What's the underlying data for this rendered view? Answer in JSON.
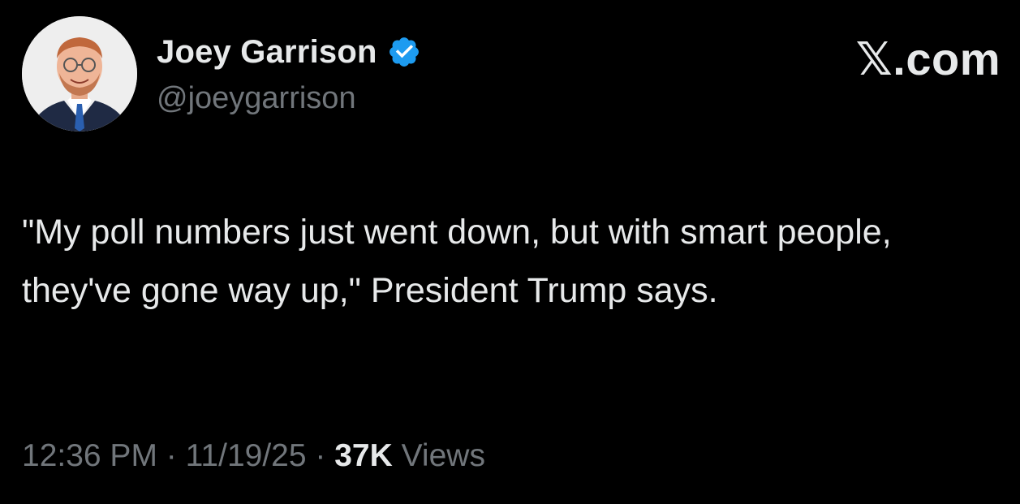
{
  "author": {
    "display_name": "Joey Garrison",
    "handle": "@joeygarrison",
    "verified": true,
    "verified_color": "#1d9bf0",
    "avatar_icon": "profile-photo"
  },
  "brand": {
    "label": "𝕏.com"
  },
  "tweet": {
    "text": "\"My poll numbers just went down, but with smart people, they've gone way up,\" President Trump says."
  },
  "meta": {
    "time": "12:36 PM",
    "separator": "·",
    "date": "11/19/25",
    "views_count": "37K",
    "views_label": "Views"
  },
  "colors": {
    "background": "#000000",
    "primary_text": "#e7e9ea",
    "secondary_text": "#71767b"
  }
}
